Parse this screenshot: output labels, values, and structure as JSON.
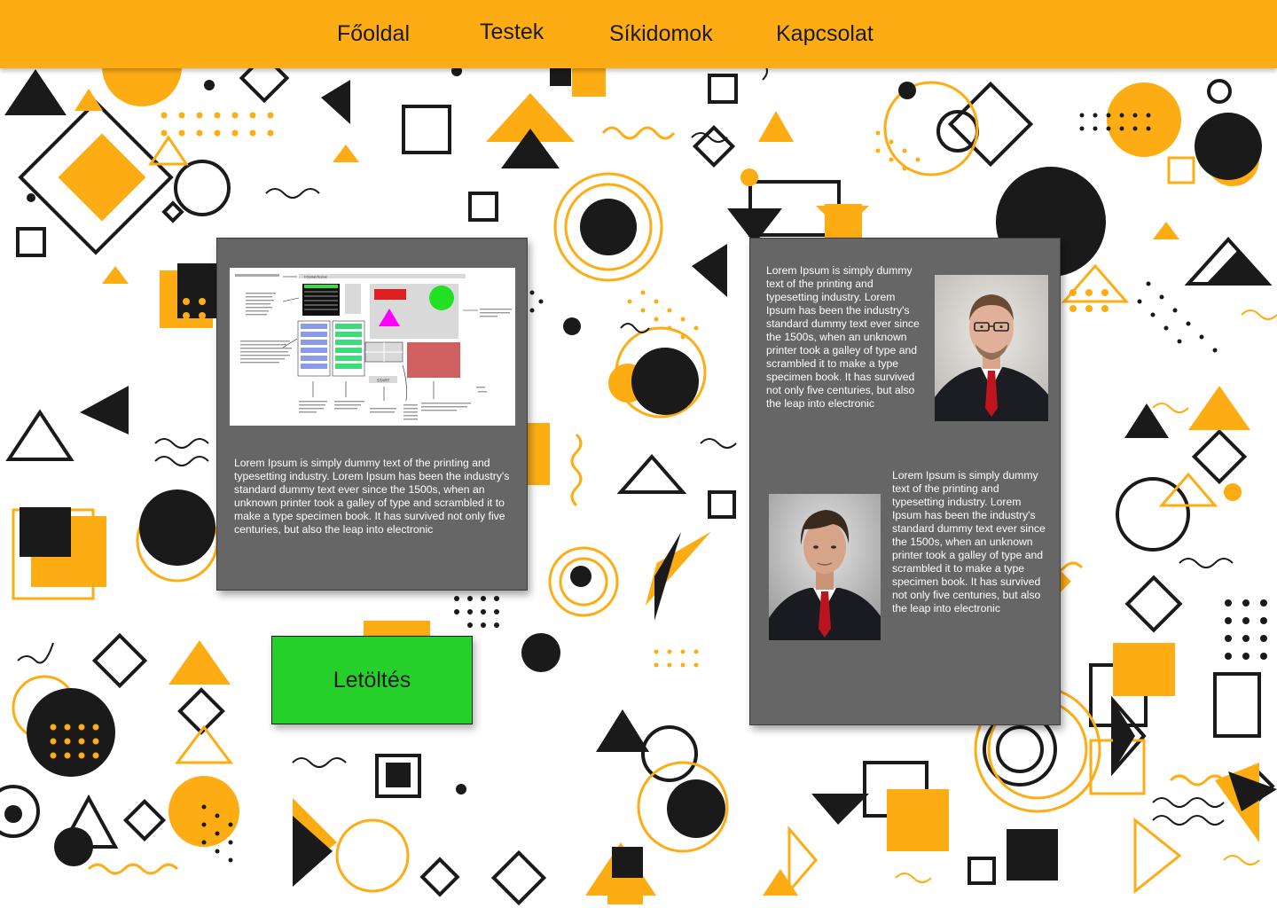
{
  "nav": {
    "items": [
      {
        "label": "Főoldal"
      },
      {
        "label": "Testek"
      },
      {
        "label": "Síkidomok"
      },
      {
        "label": "Kapcsolat"
      }
    ]
  },
  "left_card": {
    "text": "Lorem Ipsum is simply dummy text of the printing and typesetting industry. Lorem Ipsum has been the industry's standard dummy text ever since the 1500s, when an unknown printer took a galley of type and scrambled it to make a type specimen book. It has survived not only five centuries, but also the leap into electronic",
    "screenshot": {
      "header_label": "Főoldal/Testek",
      "start_label": "START"
    }
  },
  "right_card": {
    "text_top": "Lorem Ipsum is simply dummy text of the printing and typesetting industry. Lorem Ipsum has been the industry's standard dummy text ever since the 1500s, when an unknown printer took a galley of type and scrambled it to make a type specimen book. It has survived not only five centuries, but also the leap into electronic",
    "text_bottom": "Lorem Ipsum is simply dummy text of the printing and typesetting industry. Lorem Ipsum has been the industry's standard dummy text ever since the 1500s, when an unknown printer took a galley of type and scrambled it to make a type specimen book. It has survived not only five centuries, but also the leap into electronic"
  },
  "download_button": {
    "label": "Letöltés"
  },
  "colors": {
    "accent": "#fdad13",
    "dark": "#1a1a1a",
    "card": "#666666",
    "button": "#25d02a"
  }
}
